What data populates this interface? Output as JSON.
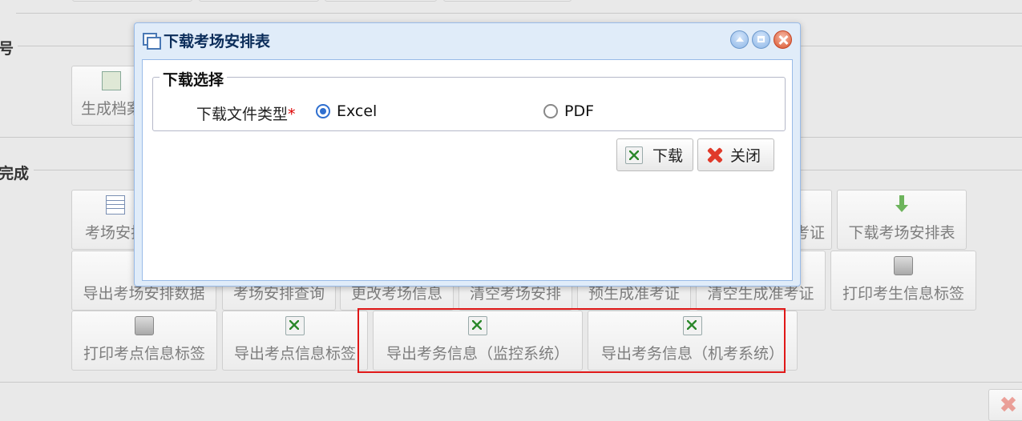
{
  "background": {
    "section_labels": [
      "号",
      "完成"
    ],
    "buttons": [
      "生成档案",
      "考场安排",
      "准考证",
      "下载考场安排表",
      "导出考场安排数据",
      "考场安排查询",
      "更改考场信息",
      "清空考场安排",
      "预生成准考证",
      "清空生成准考证",
      "打印考生信息标签",
      "打印考点信息标签",
      "导出考点信息标签",
      "导出考务信息（监控系统）",
      "导出考务信息（机考系统）"
    ]
  },
  "dialog": {
    "title": "下载考场安排表",
    "fieldset_legend": "下载选择",
    "field_label": "下载文件类型",
    "required_mark": "*",
    "options": [
      {
        "label": "Excel",
        "selected": true
      },
      {
        "label": "PDF",
        "selected": false
      }
    ],
    "download_label": "下载",
    "close_label": "关闭"
  },
  "colors": {
    "highlight_box": "#e01818",
    "dialog_title": "#0b2d5a",
    "dialog_frame": "#e0ecf9"
  }
}
